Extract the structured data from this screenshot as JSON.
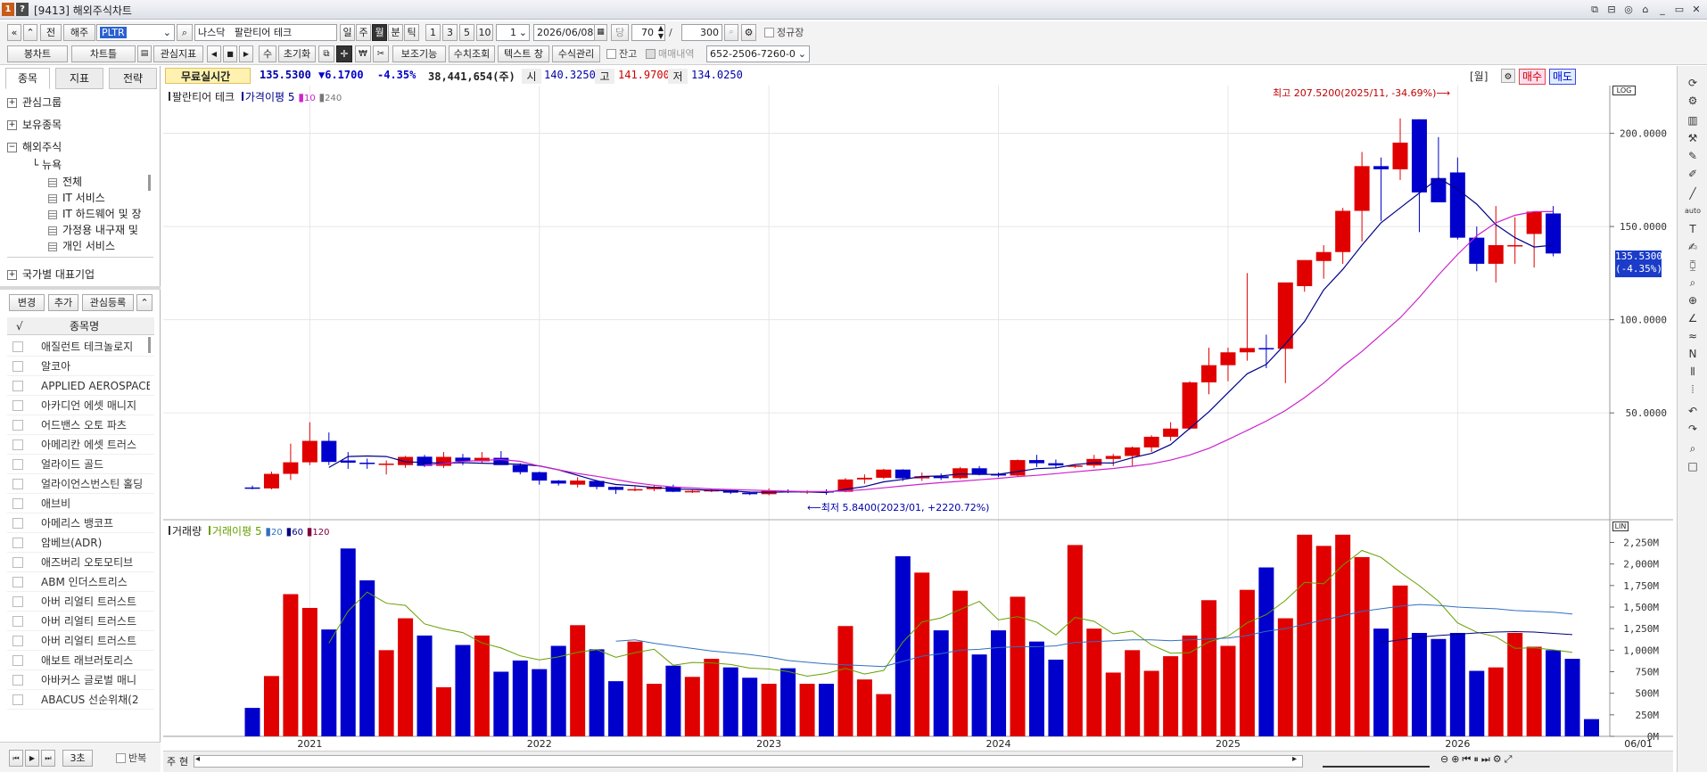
{
  "window": {
    "title": "[9413] 해외주식차트",
    "controls": [
      "⧉",
      "⊟",
      "◎",
      "⌂",
      "_",
      "▭",
      "✕"
    ]
  },
  "toolbar1": {
    "nav_prev": "«",
    "nav_up": "«",
    "btn_jeon": "전",
    "btn_haeju": "해주",
    "ticker": "PLTR",
    "market": "나스닥",
    "stock_name": "팔란티어 테크",
    "periods": [
      "일",
      "주",
      "월",
      "분",
      "틱"
    ],
    "active_period": "월",
    "intervals": [
      "1",
      "3",
      "5",
      "10"
    ],
    "interval_value": "1",
    "date": "2026/06/08",
    "btn_dang": "당",
    "count": "70",
    "slash": "/",
    "total": "300",
    "regular_label": "정규장"
  },
  "toolbar2": {
    "btn_bongchart": "봉차트",
    "btn_charttle": "차트틀",
    "btn_interest_idx": "관심지표",
    "btn_reset": "초기화",
    "btn_aux": "보조기능",
    "btn_numeric": "수치조회",
    "btn_text": "텍스트 창",
    "btn_formula": "수식관리",
    "balance_label": "잔고",
    "trade_hist_label": "매매내역",
    "account": "652-2506-7260-0",
    "su": "수"
  },
  "left_panel": {
    "tabs": [
      "종목",
      "지표",
      "전략"
    ],
    "active_tab": "종목",
    "tree": [
      {
        "label": "관심그룹",
        "sign": "+"
      },
      {
        "label": "보유종목",
        "sign": "+"
      },
      {
        "label": "해외주식",
        "sign": "−"
      }
    ],
    "sub_header": "뉴욕",
    "sub_items": [
      "전체",
      "IT 서비스",
      "IT 하드웨어 및 장",
      "가정용 내구재 및",
      "개인 서비스"
    ],
    "country_group": "국가별 대표기업",
    "buttons": [
      "변경",
      "추가",
      "관심등록",
      "⌃"
    ],
    "list_header_check": "√",
    "list_header": "종목명",
    "stocks": [
      "애질런트 테크놀로지",
      "알코아",
      "APPLIED AEROSPACE",
      "아카디언 에셋 매니지",
      "어드밴스 오토 파츠",
      "아메리칸 에셋 트러스",
      "얼라이드 골드",
      "얼라이언스번스틴 홀딩",
      "애브비",
      "아메리스 뱅코프",
      "암베브(ADR)",
      "애즈버리 오토모티브",
      "ABM 인더스트리스",
      "아버 리얼티 트러스트",
      "아버 리얼티 트러스트",
      "아버 리얼티 트러스트",
      "애보트 래브러토리스",
      "아바커스 글로벌 매니",
      "ABACUS 선순위채(2"
    ],
    "bottom": {
      "speed": "3초",
      "repeat_label": "반복"
    }
  },
  "info": {
    "realtime_label": "무료실시간",
    "price": "135.5300",
    "change": "▼6.1700",
    "change_pct": "-4.35%",
    "volume": "38,441,654(주)",
    "open_label": "시",
    "open": "140.3250",
    "high_label": "고",
    "high": "141.9700",
    "low_label": "저",
    "low": "134.0250",
    "week_label": "[월]",
    "buy_label": "매수",
    "sell_label": "매도"
  },
  "price_panel": {
    "stock_label": "팔란티어 테크",
    "ma_label": "가격이평",
    "ma_periods": [
      "5",
      "10",
      "240"
    ],
    "max_label": "최고 207.5200(2025/11, -34.69%)",
    "min_label": "최저 5.8400(2023/01, +2220.72%)",
    "current_tag": "135.5300",
    "current_pct": "(-4.35%)",
    "log_badge": "LOG",
    "colors": {
      "up": "#e00000",
      "down": "#0000cc",
      "ma5": "#00008b",
      "ma10": "#cc22cc"
    }
  },
  "volume_panel": {
    "label": "거래량",
    "ma_label": "거래이평",
    "ma_periods": [
      "5",
      "20",
      "60",
      "120"
    ],
    "log_badge": "LIN",
    "colors": {
      "ma5": "#66a000",
      "ma20": "#3070c0",
      "ma60": "#000080",
      "ma120": "#800040"
    }
  },
  "x_axis": {
    "labels": [
      "2021",
      "2022",
      "2023",
      "2024",
      "2025",
      "2026"
    ],
    "last_date": "06/01"
  },
  "scroll": {
    "left_label": "주",
    "left_label2": "현"
  },
  "chart_data": [
    {
      "type": "candlestick",
      "title": "팔란티어 테크",
      "interval": "monthly",
      "y_ticks": [
        50,
        100,
        150,
        200
      ],
      "y_tick_labels": [
        "50.0000",
        "100.0000",
        "150.0000",
        "200.0000"
      ],
      "ylim": [
        -3,
        217
      ],
      "x": [
        "2020-10",
        "2020-11",
        "2020-12",
        "2021-01",
        "2021-02",
        "2021-03",
        "2021-04",
        "2021-05",
        "2021-06",
        "2021-07",
        "2021-08",
        "2021-09",
        "2021-10",
        "2021-11",
        "2021-12",
        "2022-01",
        "2022-02",
        "2022-03",
        "2022-04",
        "2022-05",
        "2022-06",
        "2022-07",
        "2022-08",
        "2022-09",
        "2022-10",
        "2022-11",
        "2022-12",
        "2023-01",
        "2023-02",
        "2023-03",
        "2023-04",
        "2023-05",
        "2023-06",
        "2023-07",
        "2023-08",
        "2023-09",
        "2023-10",
        "2023-11",
        "2023-12",
        "2024-01",
        "2024-02",
        "2024-03",
        "2024-04",
        "2024-05",
        "2024-06",
        "2024-07",
        "2024-08",
        "2024-09",
        "2024-10",
        "2024-11",
        "2024-12",
        "2025-01",
        "2025-02",
        "2025-03",
        "2025-04",
        "2025-05",
        "2025-06",
        "2025-07",
        "2025-08",
        "2025-09",
        "2025-10",
        "2025-11",
        "2025-12",
        "2026-01",
        "2026-02",
        "2026-03",
        "2026-04",
        "2026-05",
        "2026-06"
      ],
      "ohlc": [
        [
          10.0,
          11.0,
          9.0,
          9.5
        ],
        [
          9.5,
          18.5,
          9.0,
          17.3
        ],
        [
          17.3,
          33.5,
          14.0,
          23.5
        ],
        [
          23.5,
          45.0,
          22.0,
          35.0
        ],
        [
          35.0,
          39.5,
          22.0,
          23.7
        ],
        [
          24.5,
          29.0,
          20.0,
          23.3
        ],
        [
          23.3,
          25.5,
          20.0,
          22.9
        ],
        [
          22.8,
          24.5,
          17.0,
          22.8
        ],
        [
          22.0,
          27.0,
          20.5,
          26.4
        ],
        [
          26.5,
          27.5,
          21.0,
          21.6
        ],
        [
          21.6,
          29.0,
          20.5,
          26.4
        ],
        [
          26.0,
          28.0,
          22.0,
          24.0
        ],
        [
          24.0,
          29.0,
          23.0,
          25.9
        ],
        [
          25.9,
          29.5,
          23.0,
          22.0
        ],
        [
          22.0,
          23.0,
          17.0,
          18.2
        ],
        [
          18.2,
          18.5,
          11.5,
          13.7
        ],
        [
          13.7,
          14.0,
          11.0,
          12.1
        ],
        [
          11.5,
          15.5,
          10.0,
          13.7
        ],
        [
          13.5,
          14.0,
          9.0,
          10.3
        ],
        [
          10.3,
          10.5,
          6.5,
          8.7
        ],
        [
          8.7,
          10.5,
          8.0,
          9.1
        ],
        [
          9.1,
          11.5,
          8.0,
          10.4
        ],
        [
          10.4,
          11.5,
          7.5,
          7.7
        ],
        [
          7.7,
          9.0,
          7.0,
          8.1
        ],
        [
          8.1,
          9.5,
          7.5,
          8.6
        ],
        [
          8.6,
          9.0,
          6.5,
          7.2
        ],
        [
          7.2,
          7.5,
          5.9,
          6.4
        ],
        [
          6.4,
          9.5,
          5.84,
          8.2
        ],
        [
          8.2,
          9.0,
          7.0,
          7.7
        ],
        [
          7.7,
          8.5,
          6.5,
          8.0
        ],
        [
          8.0,
          9.0,
          6.0,
          7.7
        ],
        [
          7.7,
          15.0,
          7.5,
          14.3
        ],
        [
          14.3,
          17.0,
          12.0,
          15.2
        ],
        [
          15.2,
          20.0,
          14.5,
          19.6
        ],
        [
          19.6,
          19.8,
          13.5,
          14.9
        ],
        [
          14.9,
          18.0,
          13.5,
          16.0
        ],
        [
          16.0,
          17.5,
          14.0,
          15.0
        ],
        [
          15.0,
          21.0,
          14.5,
          20.3
        ],
        [
          20.3,
          21.5,
          16.5,
          17.2
        ],
        [
          17.2,
          18.0,
          15.5,
          16.4
        ],
        [
          16.4,
          25.0,
          16.0,
          24.7
        ],
        [
          24.7,
          27.5,
          21.0,
          23.0
        ],
        [
          23.0,
          25.0,
          20.5,
          21.8
        ],
        [
          21.8,
          22.0,
          20.5,
          21.8
        ],
        [
          21.8,
          27.5,
          20.5,
          25.3
        ],
        [
          25.3,
          28.0,
          21.5,
          26.9
        ],
        [
          26.9,
          32.0,
          21.5,
          31.5
        ],
        [
          31.5,
          38.0,
          29.0,
          37.2
        ],
        [
          37.2,
          45.0,
          35.0,
          41.6
        ],
        [
          41.6,
          67.0,
          41.0,
          66.4
        ],
        [
          66.4,
          85.0,
          60.0,
          75.6
        ],
        [
          75.6,
          85.0,
          67.0,
          82.5
        ],
        [
          82.5,
          125.0,
          78.0,
          84.8
        ],
        [
          84.8,
          92.0,
          74.0,
          84.4
        ],
        [
          84.4,
          119.0,
          66.0,
          120.0
        ],
        [
          118.0,
          125.0,
          115.0,
          132.0
        ],
        [
          131.5,
          140.0,
          122.0,
          136.3
        ],
        [
          136.3,
          160.0,
          130.0,
          158.4
        ],
        [
          158.4,
          190.0,
          142.0,
          182.4
        ],
        [
          182.4,
          187.0,
          153.0,
          180.7
        ],
        [
          180.7,
          208.0,
          175.0,
          195.0
        ],
        [
          207.52,
          207.52,
          147.0,
          168.3
        ],
        [
          176.0,
          198.0,
          163.0,
          163.0
        ],
        [
          179.0,
          187.0,
          143.0,
          144.0
        ],
        [
          144.0,
          150.0,
          126.0,
          130.0
        ],
        [
          130.0,
          161.0,
          120.0,
          140.0
        ],
        [
          140.0,
          155.0,
          130.0,
          140.0
        ],
        [
          146.0,
          158.0,
          128.0,
          158.0
        ],
        [
          157.0,
          161.0,
          134.0,
          135.53
        ]
      ],
      "ma5": [
        null,
        null,
        null,
        null,
        20.7,
        26.6,
        26.9,
        26.6,
        23.8,
        23.4,
        23.0,
        23.3,
        23.0,
        22.8,
        22.4,
        21.6,
        19.5,
        16.5,
        13.6,
        11.6,
        10.9,
        10.0,
        9.2,
        8.9,
        8.5,
        8.2,
        7.5,
        7.4,
        7.6,
        7.6,
        7.3,
        9.0,
        10.5,
        13.0,
        14.3,
        15.9,
        16.2,
        17.3,
        17.0,
        17.1,
        18.5,
        20.1,
        20.5,
        22.3,
        23.2,
        23.1,
        26.0,
        28.3,
        33.0,
        41.7,
        50.6,
        60.9,
        71.0,
        76.0,
        87.0,
        99.0,
        116.0,
        127.0,
        140.0,
        152.0,
        160.0,
        168.0,
        176.0,
        170.0,
        162.0,
        151.0,
        144.0,
        139.0,
        140.0
      ],
      "ma10": [
        null,
        null,
        null,
        null,
        null,
        null,
        null,
        null,
        null,
        22.0,
        22.8,
        24.0,
        24.5,
        25.0,
        24.0,
        21.5,
        19.5,
        17.5,
        16.0,
        14.2,
        12.5,
        11.2,
        10.3,
        9.8,
        9.2,
        8.9,
        8.6,
        8.3,
        8.0,
        7.8,
        7.8,
        8.2,
        8.8,
        9.8,
        10.8,
        11.8,
        12.6,
        13.3,
        14.1,
        14.9,
        15.8,
        16.5,
        17.4,
        18.4,
        19.3,
        20.2,
        21.4,
        22.7,
        24.7,
        27.4,
        31.0,
        35.7,
        40.6,
        45.6,
        51.3,
        58.2,
        66.0,
        75.0,
        83.0,
        92.0,
        101.0,
        112.0,
        124.0,
        135.0,
        145.0,
        152.0,
        156.0,
        158.0,
        158.0
      ]
    },
    {
      "type": "bar",
      "title": "거래량",
      "unit": "M",
      "y_ticks": [
        0,
        250,
        500,
        750,
        1000,
        1250,
        1500,
        1750,
        2000,
        2250
      ],
      "y_tick_labels": [
        "0M",
        "250M",
        "500M",
        "750M",
        "1,000M",
        "1,250M",
        "1,500M",
        "1,750M",
        "2,000M",
        "2,250M"
      ],
      "ylim": [
        0,
        2400
      ],
      "values": [
        330,
        700,
        1650,
        1490,
        1240,
        2180,
        1810,
        1000,
        1370,
        1170,
        570,
        1060,
        1170,
        750,
        880,
        780,
        1050,
        1290,
        1010,
        640,
        1100,
        610,
        820,
        690,
        900,
        800,
        680,
        610,
        790,
        610,
        610,
        1280,
        660,
        490,
        2090,
        1900,
        1230,
        1690,
        950,
        1230,
        1620,
        1100,
        890,
        2220,
        1250,
        740,
        1000,
        760,
        930,
        1170,
        1580,
        1050,
        1700,
        1960,
        1370,
        2340,
        2210,
        2340,
        2080,
        1250,
        1750,
        1200,
        1130,
        1200,
        760,
        800,
        1200,
        1040,
        1000,
        900,
        200
      ],
      "ma5": [
        null,
        null,
        null,
        null,
        1082,
        1452,
        1674,
        1544,
        1520,
        1306,
        1246,
        1204,
        1084,
        1025,
        934,
        887,
        922,
        975,
        1007,
        917,
        971,
        1011,
        824,
        858,
        852,
        834,
        791,
        782,
        752,
        698,
        729,
        788,
        723,
        765,
        1093,
        1327,
        1375,
        1472,
        1566,
        1351,
        1389,
        1325,
        1176,
        1380,
        1335,
        1190,
        1222,
        1060,
        965,
        971,
        1097,
        1163,
        1317,
        1412,
        1578,
        1787,
        1770,
        1985,
        2157,
        2077,
        1904,
        1748,
        1568,
        1317,
        1208,
        1156,
        1021,
        1028,
        1003,
        975
      ],
      "ma20": [
        null,
        null,
        null,
        null,
        null,
        null,
        null,
        null,
        null,
        null,
        null,
        null,
        null,
        null,
        null,
        null,
        null,
        null,
        null,
        1105,
        1120,
        1080,
        1050,
        1020,
        990,
        970,
        950,
        920,
        880,
        860,
        840,
        830,
        820,
        810,
        870,
        930,
        960,
        1000,
        1010,
        1030,
        1040,
        1040,
        1050,
        1090,
        1100,
        1110,
        1120,
        1120,
        1110,
        1120,
        1130,
        1140,
        1170,
        1220,
        1250,
        1300,
        1350,
        1400,
        1450,
        1480,
        1510,
        1530,
        1520,
        1500,
        1490,
        1480,
        1460,
        1450,
        1440,
        1420
      ],
      "ma60": [
        null,
        null,
        null,
        null,
        null,
        null,
        null,
        null,
        null,
        null,
        null,
        null,
        null,
        null,
        null,
        null,
        null,
        null,
        null,
        null,
        null,
        null,
        null,
        null,
        null,
        null,
        null,
        null,
        null,
        null,
        null,
        null,
        null,
        null,
        null,
        null,
        null,
        null,
        null,
        null,
        null,
        null,
        null,
        null,
        null,
        null,
        null,
        null,
        null,
        null,
        null,
        null,
        null,
        null,
        null,
        null,
        null,
        null,
        null,
        1090,
        1120,
        1150,
        1170,
        1185,
        1200,
        1210,
        1215,
        1210,
        1195,
        1180
      ],
      "ma120": []
    }
  ]
}
